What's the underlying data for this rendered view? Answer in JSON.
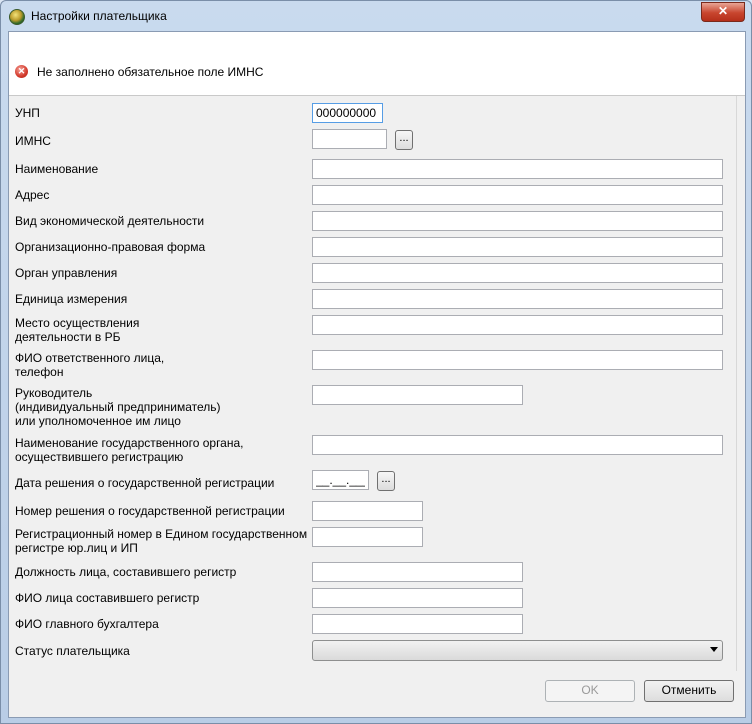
{
  "window": {
    "title": "Настройки плательщика",
    "close_label": "✕",
    "accent_color": "#c8452e"
  },
  "message": {
    "icon": "error-icon",
    "text": "Не заполнено обязательное поле ИМНС"
  },
  "fields": {
    "unp": {
      "label": "УНП",
      "value": "000000000"
    },
    "imns": {
      "label": "ИМНС",
      "value": "",
      "browse_label": "..."
    },
    "name": {
      "label": "Наименование",
      "value": ""
    },
    "address": {
      "label": "Адрес",
      "value": ""
    },
    "activity": {
      "label": "Вид экономической деятельности",
      "value": ""
    },
    "legal_form": {
      "label": "Организационно-правовая форма",
      "value": ""
    },
    "authority": {
      "label": "Орган управления",
      "value": ""
    },
    "unit": {
      "label": "Единица измерения",
      "value": ""
    },
    "place": {
      "label_line1": "Место осуществления",
      "label_line2": "деятельности в РБ",
      "value": ""
    },
    "responsible": {
      "label_line1": "ФИО ответственного лица,",
      "label_line2": "телефон",
      "value": ""
    },
    "head": {
      "label_line1": "Руководитель",
      "label_line2": "(индивидуальный предприниматель)",
      "label_line3": "или уполномоченное им лицо",
      "value": ""
    },
    "reg_body": {
      "label_line1": "Наименование государственного органа,",
      "label_line2": "осуществившего регистрацию",
      "value": ""
    },
    "reg_date": {
      "label": "Дата решения о государственной регистрации",
      "value": "__.__.____",
      "browse_label": "..."
    },
    "reg_decision": {
      "label": "Номер решения о государственной регистрации",
      "value": ""
    },
    "reg_number": {
      "label_line1": "Регистрационный номер в Едином государственном",
      "label_line2": "регистре юр.лиц и ИП",
      "value": ""
    },
    "registrar_position": {
      "label": "Должность лица, составившего регистр",
      "value": ""
    },
    "registrar_name": {
      "label": "ФИО лица составившего регистр",
      "value": ""
    },
    "accountant": {
      "label": "ФИО главного бухгалтера",
      "value": ""
    },
    "status": {
      "label": "Статус плательщика",
      "value": ""
    }
  },
  "buttons": {
    "ok": "OK",
    "cancel": "Отменить"
  }
}
